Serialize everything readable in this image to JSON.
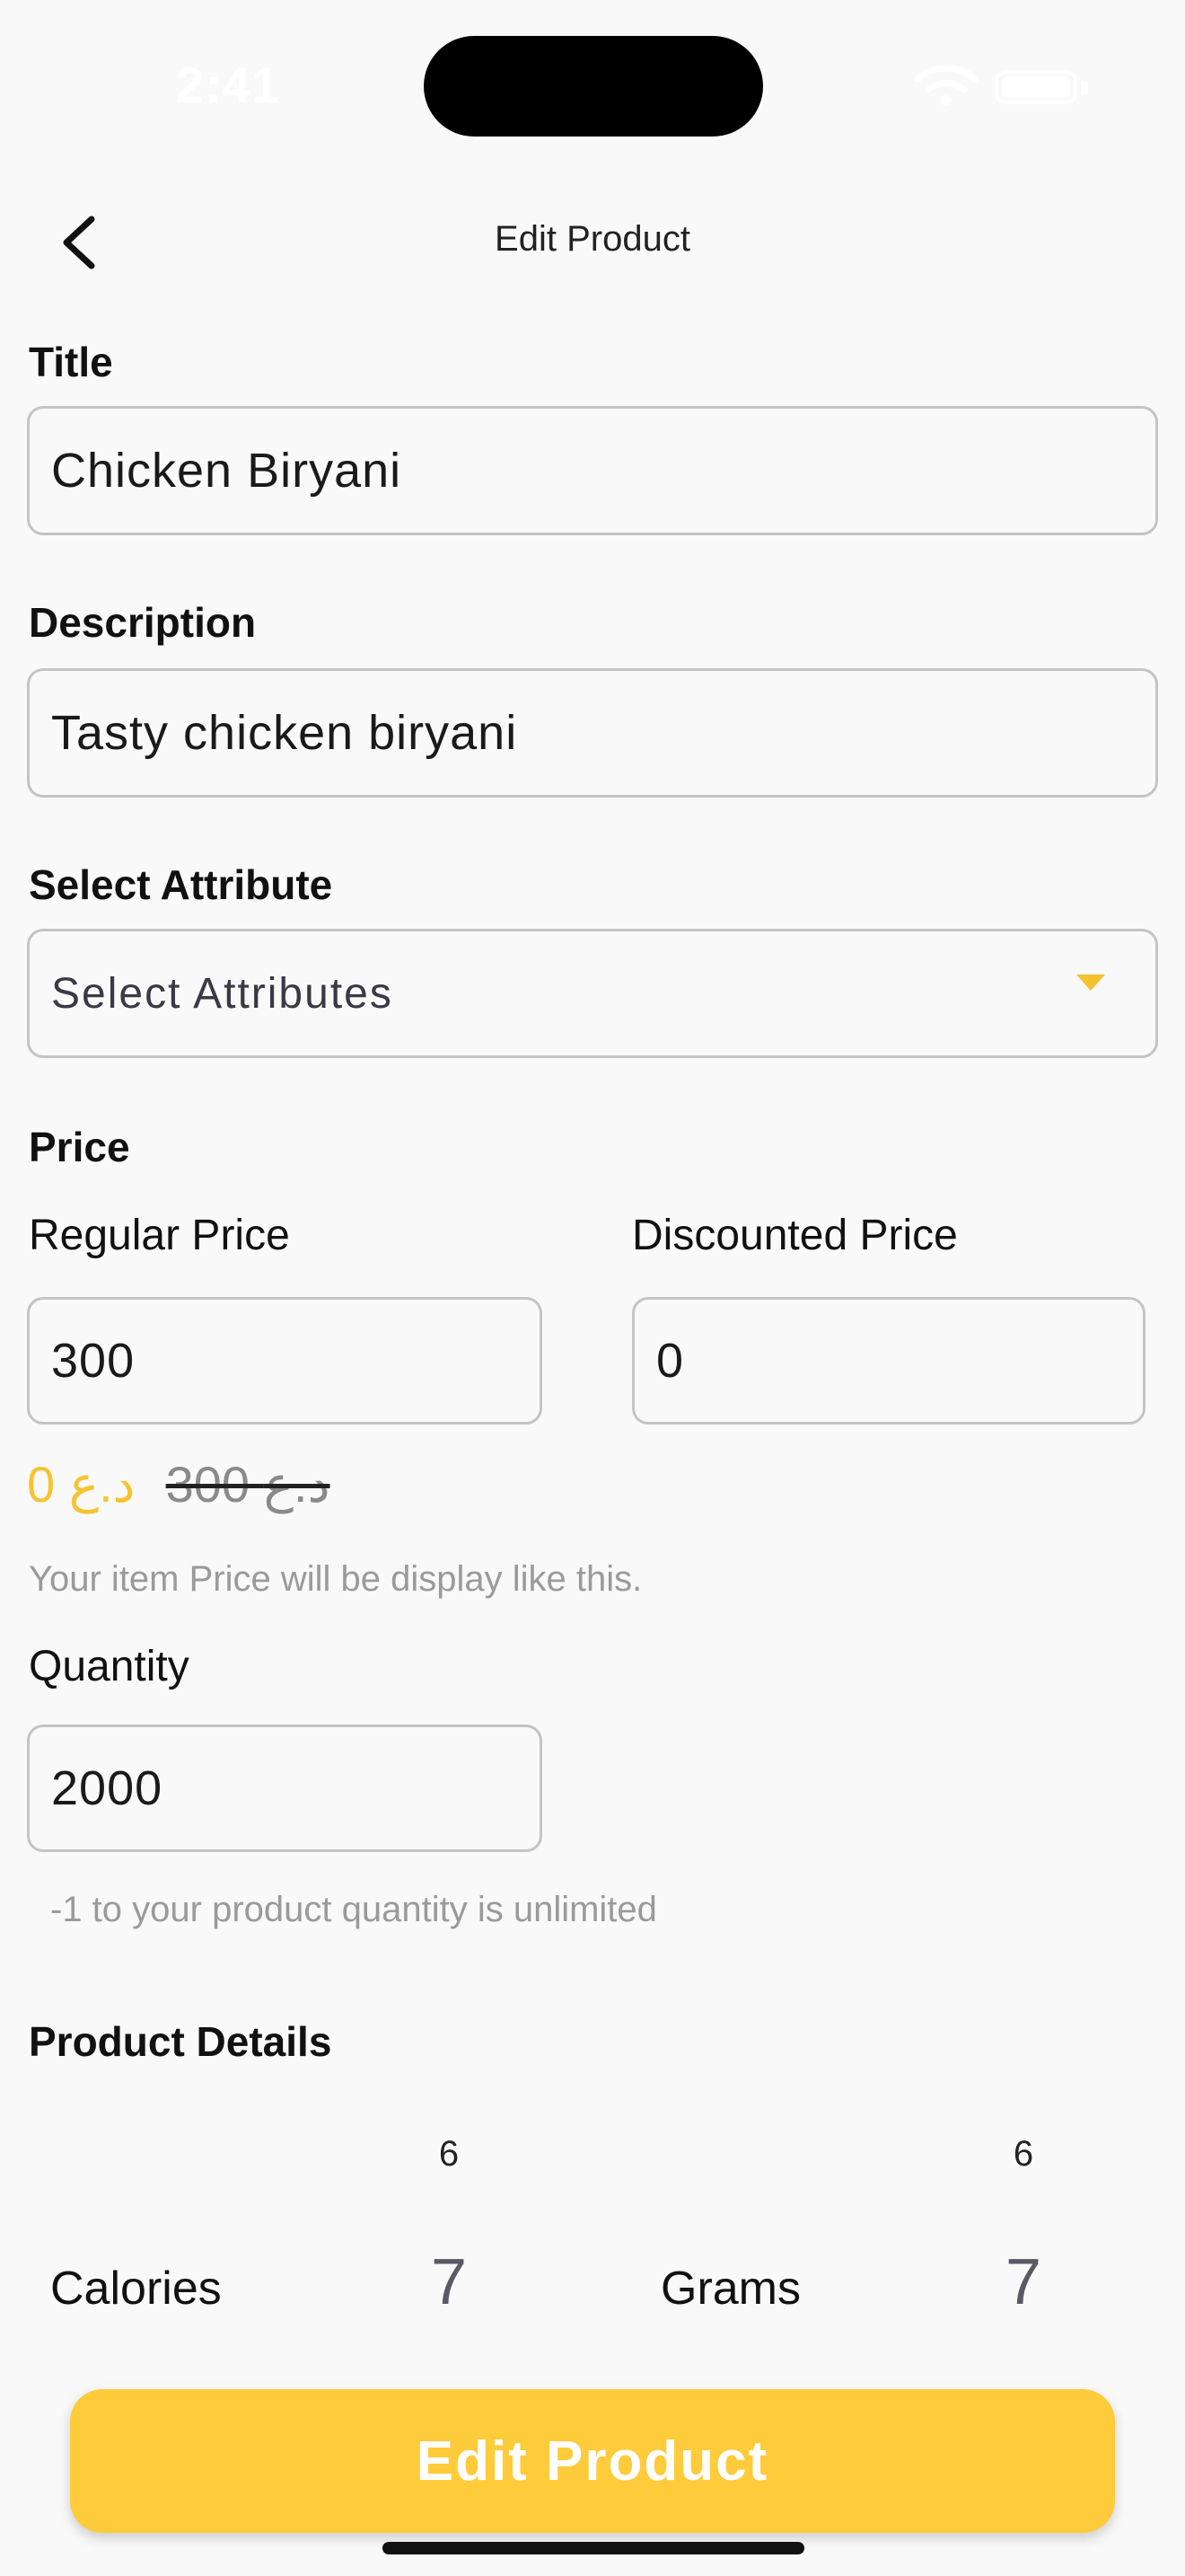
{
  "status_bar": {
    "time": "2:41"
  },
  "header": {
    "title": "Edit Product"
  },
  "form": {
    "title_label": "Title",
    "title_value": "Chicken Biryani",
    "description_label": "Description",
    "description_value": "Tasty chicken biryani",
    "attribute_label": "Select Attribute",
    "attribute_placeholder": "Select Attributes",
    "price_label": "Price",
    "regular_price_label": "Regular Price",
    "regular_price_value": "300",
    "discounted_price_label": "Discounted Price",
    "discounted_price_value": "0",
    "price_preview_new": "0 د.ع",
    "price_preview_old": "300 د.ع",
    "price_hint": "Your item Price will be display like this.",
    "quantity_label": "Quantity",
    "quantity_value": "2000",
    "quantity_hint": "-1 to your product quantity is unlimited",
    "details_label": "Product Details"
  },
  "details": {
    "calories_label": "Calories",
    "calories_prev": "6",
    "calories_value": "7",
    "grams_label": "Grams",
    "grams_prev": "6",
    "grams_value": "7"
  },
  "actions": {
    "edit_label": "Edit Product"
  },
  "colors": {
    "accent": "#fecb3b",
    "preview_price": "#f6c430",
    "background": "#f9f9f9"
  }
}
